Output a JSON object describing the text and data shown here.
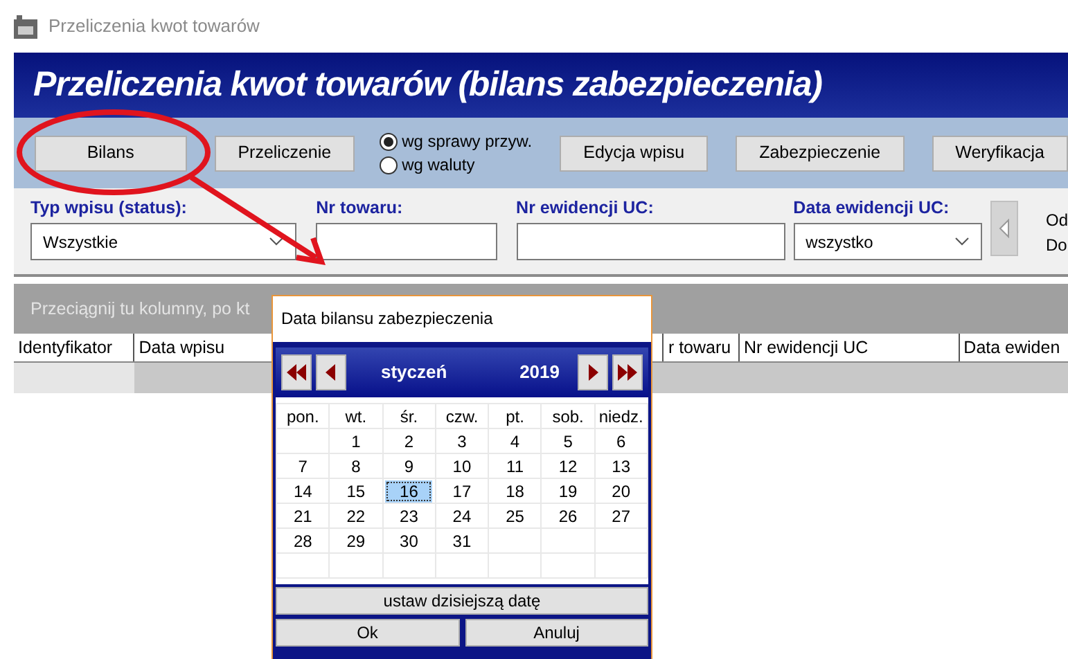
{
  "window": {
    "title": "Przeliczenia kwot towarów"
  },
  "banner": {
    "title": "Przeliczenia kwot towarów (bilans zabezpieczenia)"
  },
  "toolbar": {
    "buttons_left": [
      "Bilans",
      "Przeliczenie"
    ],
    "radios": [
      {
        "label": "wg sprawy przyw.",
        "selected": true
      },
      {
        "label": "wg waluty",
        "selected": false
      }
    ],
    "buttons_right": [
      "Edycja wpisu",
      "Zabezpieczenie",
      "Weryfikacja"
    ]
  },
  "filters": [
    {
      "kind": "select",
      "label": "Typ wpisu (status):",
      "value": "Wszystkie"
    },
    {
      "kind": "input",
      "label": "Nr towaru:"
    },
    {
      "kind": "input",
      "label": "Nr ewidencji UC:"
    },
    {
      "kind": "select",
      "label": "Data ewidencji UC:",
      "value": "wszystko"
    }
  ],
  "range_labels": [
    "Od",
    "Do"
  ],
  "grid": {
    "group_hint": "Przeciągnij tu kolumny, po kt",
    "columns": [
      {
        "label": "Identyfikator"
      },
      {
        "label": "Data wpisu"
      },
      {
        "label": "r towaru"
      },
      {
        "label": "Nr ewidencji UC"
      },
      {
        "label": "Data ewiden"
      }
    ]
  },
  "dialog": {
    "title": "Data bilansu zabezpieczenia",
    "month": "styczeń",
    "year": "2019",
    "weekdays": [
      "pon.",
      "wt.",
      "śr.",
      "czw.",
      "pt.",
      "sob.",
      "niedz."
    ],
    "weeks": [
      [
        {
          "kind": "blank"
        },
        {
          "kind": "day",
          "d": "1",
          "selected": false
        },
        {
          "kind": "day",
          "d": "2",
          "selected": false
        },
        {
          "kind": "day",
          "d": "3",
          "selected": false
        },
        {
          "kind": "day",
          "d": "4",
          "selected": false
        },
        {
          "kind": "day",
          "d": "5",
          "selected": false
        },
        {
          "kind": "day",
          "d": "6",
          "selected": false
        }
      ],
      [
        {
          "kind": "day",
          "d": "7",
          "selected": false
        },
        {
          "kind": "day",
          "d": "8",
          "selected": false
        },
        {
          "kind": "day",
          "d": "9",
          "selected": false
        },
        {
          "kind": "day",
          "d": "10",
          "selected": false
        },
        {
          "kind": "day",
          "d": "11",
          "selected": false
        },
        {
          "kind": "day",
          "d": "12",
          "selected": false
        },
        {
          "kind": "day",
          "d": "13",
          "selected": false
        }
      ],
      [
        {
          "kind": "day",
          "d": "14",
          "selected": false
        },
        {
          "kind": "day",
          "d": "15",
          "selected": false
        },
        {
          "kind": "day",
          "d": "16",
          "selected": true
        },
        {
          "kind": "day",
          "d": "17",
          "selected": false
        },
        {
          "kind": "day",
          "d": "18",
          "selected": false
        },
        {
          "kind": "day",
          "d": "19",
          "selected": false
        },
        {
          "kind": "day",
          "d": "20",
          "selected": false
        }
      ],
      [
        {
          "kind": "day",
          "d": "21",
          "selected": false
        },
        {
          "kind": "day",
          "d": "22",
          "selected": false
        },
        {
          "kind": "day",
          "d": "23",
          "selected": false
        },
        {
          "kind": "day",
          "d": "24",
          "selected": false
        },
        {
          "kind": "day",
          "d": "25",
          "selected": false
        },
        {
          "kind": "day",
          "d": "26",
          "selected": false
        },
        {
          "kind": "day",
          "d": "27",
          "selected": false
        }
      ],
      [
        {
          "kind": "day",
          "d": "28",
          "selected": false
        },
        {
          "kind": "day",
          "d": "29",
          "selected": false
        },
        {
          "kind": "day",
          "d": "30",
          "selected": false
        },
        {
          "kind": "day",
          "d": "31",
          "selected": false
        },
        {
          "kind": "blank"
        },
        {
          "kind": "blank"
        },
        {
          "kind": "blank"
        }
      ],
      [
        {
          "kind": "blank"
        },
        {
          "kind": "blank"
        },
        {
          "kind": "blank"
        },
        {
          "kind": "blank"
        },
        {
          "kind": "blank"
        },
        {
          "kind": "blank"
        },
        {
          "kind": "blank"
        }
      ]
    ],
    "today_button": "ustaw dzisiejszą datę",
    "buttons": [
      "Ok",
      "Anuluj"
    ]
  }
}
